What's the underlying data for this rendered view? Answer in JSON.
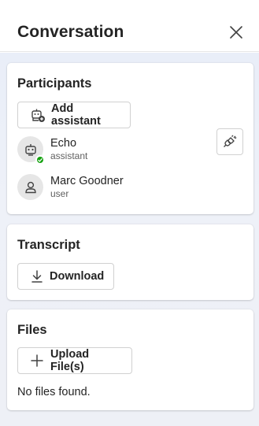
{
  "header": {
    "title": "Conversation",
    "close_icon": "close-icon"
  },
  "participants": {
    "title": "Participants",
    "add_button_label": "Add assistant",
    "items": [
      {
        "name": "Echo",
        "role": "assistant",
        "icon": "bot-icon",
        "status": "online"
      },
      {
        "name": "Marc Goodner",
        "role": "user",
        "icon": "person-icon"
      }
    ],
    "action_icon": "plug-disconnected-icon"
  },
  "transcript": {
    "title": "Transcript",
    "download_label": "Download"
  },
  "files": {
    "title": "Files",
    "upload_label": "Upload File(s)",
    "empty_text": "No files found."
  },
  "colors": {
    "status_online": "#13a10e",
    "content_bg": "#eef1f8"
  }
}
